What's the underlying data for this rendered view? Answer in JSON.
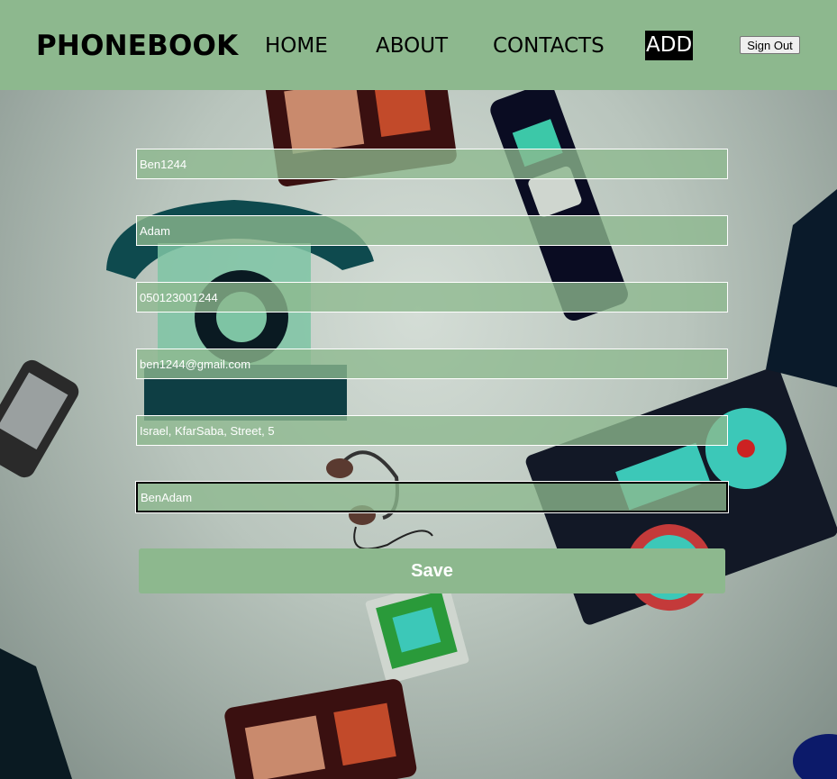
{
  "app": {
    "brand": "PHONEBOOK"
  },
  "nav": {
    "home": "HOME",
    "about": "ABOUT",
    "contacts": "CONTACTS",
    "add": "ADD",
    "sign_out": "Sign Out"
  },
  "form": {
    "fields": [
      {
        "value": "Ben1244"
      },
      {
        "value": "Adam"
      },
      {
        "value": "050123001244"
      },
      {
        "value": "ben1244@gmail.com"
      },
      {
        "value": "Israel, KfarSaba, Street, 5"
      },
      {
        "value": "BenAdam"
      }
    ],
    "save_label": "Save"
  },
  "colors": {
    "accent": "#8db88e",
    "active_nav_bg": "#000000"
  },
  "icons": [
    "rotary-telephone-icon",
    "mobile-phone-icon",
    "boombox-icon",
    "radio-icon",
    "headphones-icon",
    "cassette-player-icon"
  ]
}
